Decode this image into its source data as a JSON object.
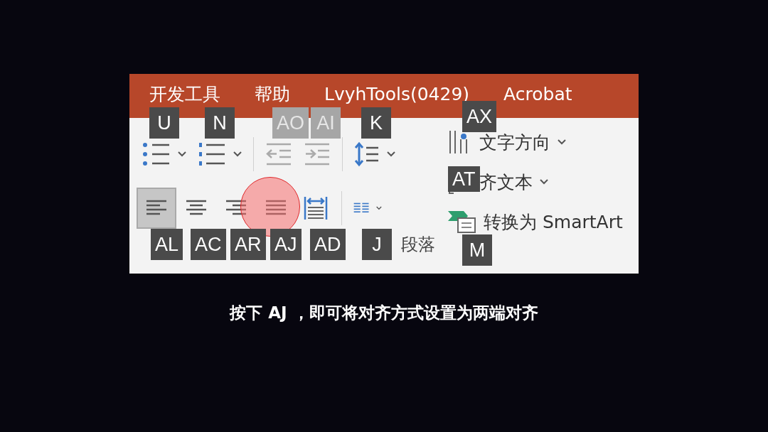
{
  "tabs": [
    {
      "label": "开发工具"
    },
    {
      "label": "帮助"
    },
    {
      "label": "LvyhTools(0429)"
    },
    {
      "label": "Acrobat"
    }
  ],
  "paragraph_group": {
    "label": "段落",
    "row_1": [
      {
        "kind": "bullets",
        "dropdown": true,
        "keytip": {
          "label": "U",
          "dimmed": false
        }
      },
      {
        "kind": "numbering",
        "dropdown": true,
        "keytip": {
          "label": "N",
          "dimmed": false
        }
      },
      {
        "kind": "outdent",
        "dropdown": false,
        "keytip": {
          "label": "AO",
          "dimmed": true
        }
      },
      {
        "kind": "indent",
        "dropdown": false,
        "keytip": {
          "label": "AI",
          "dimmed": true
        }
      },
      {
        "kind": "line-spacing",
        "dropdown": true,
        "keytip": {
          "label": "K",
          "dimmed": false
        }
      }
    ],
    "row_2": [
      {
        "kind": "align-left",
        "dropdown": false,
        "selected": true,
        "clicked": false,
        "keytip": {
          "label": "AL",
          "dimmed": false
        }
      },
      {
        "kind": "align-center",
        "dropdown": false,
        "selected": false,
        "clicked": false,
        "keytip": {
          "label": "AC",
          "dimmed": false
        }
      },
      {
        "kind": "align-right",
        "dropdown": false,
        "selected": false,
        "clicked": false,
        "keytip": {
          "label": "AR",
          "dimmed": false
        }
      },
      {
        "kind": "justify",
        "dropdown": false,
        "selected": false,
        "clicked": true,
        "keytip": {
          "label": "AJ",
          "dimmed": false
        }
      },
      {
        "kind": "distribute",
        "dropdown": false,
        "selected": false,
        "clicked": false,
        "keytip": {
          "label": "AD",
          "dimmed": false
        }
      },
      {
        "kind": "columns",
        "dropdown": true,
        "selected": false,
        "clicked": false,
        "keytip": {
          "label": "J",
          "dimmed": false
        }
      }
    ]
  },
  "text_options": [
    {
      "kind": "text-direction",
      "label": "文字方向",
      "dropdown": true,
      "keytip": {
        "label": "AX",
        "dimmed": false
      }
    },
    {
      "kind": "align-text",
      "label": "齐文本",
      "dropdown": true,
      "keytip": {
        "label": "AT",
        "dimmed": false
      }
    },
    {
      "kind": "smartart",
      "label": "转换为 SmartArt",
      "dropdown": false,
      "keytip": {
        "label": "M",
        "dimmed": false
      }
    }
  ],
  "caption": "按下 AJ ，即可将对齐方式设置为两端对齐"
}
